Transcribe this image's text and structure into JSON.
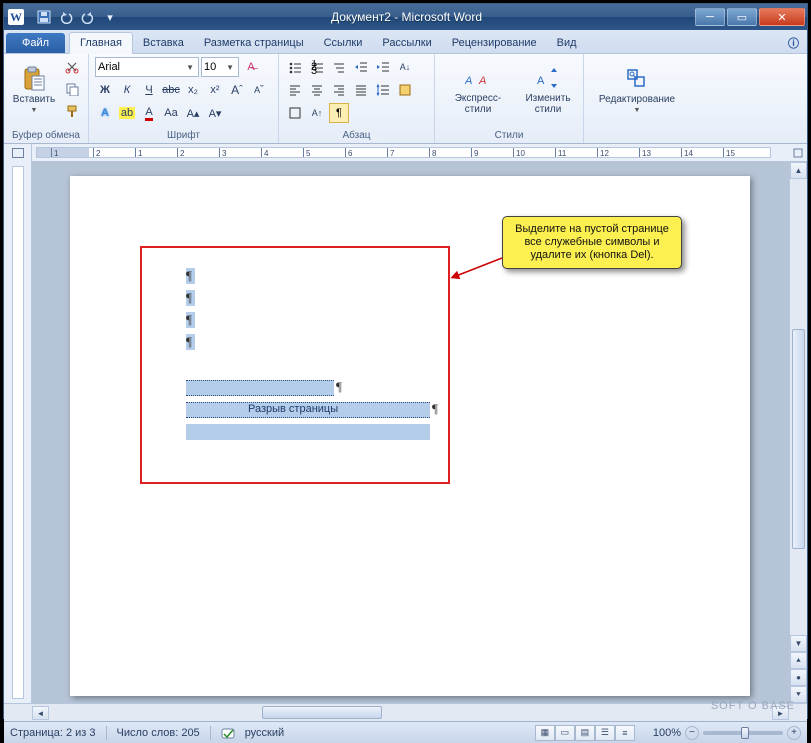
{
  "window": {
    "title": "Документ2 - Microsoft Word",
    "word_icon_letter": "W"
  },
  "tabs": {
    "file": "Файл",
    "items": [
      "Главная",
      "Вставка",
      "Разметка страницы",
      "Ссылки",
      "Рассылки",
      "Рецензирование",
      "Вид"
    ],
    "active_index": 0
  },
  "ribbon": {
    "clipboard": {
      "paste": "Вставить",
      "group": "Буфер обмена"
    },
    "font": {
      "name": "Arial",
      "size": "10",
      "group": "Шрифт",
      "bold": "Ж",
      "italic": "К",
      "underline": "Ч",
      "strike": "abc",
      "sub": "x₂",
      "sup": "x²",
      "grow": "A",
      "shrink": "A",
      "case": "Aa",
      "clear": "A"
    },
    "paragraph": {
      "group": "Абзац",
      "show_marks": "¶"
    },
    "styles": {
      "quick": "Экспресс-стили",
      "change": "Изменить стили",
      "group": "Стили"
    },
    "editing": {
      "label": "Редактирование"
    }
  },
  "ruler": {
    "marks": [
      "1",
      "2",
      "1",
      "2",
      "3",
      "4",
      "5",
      "6",
      "7",
      "8",
      "9",
      "10",
      "11",
      "12",
      "13",
      "14",
      "15"
    ]
  },
  "document": {
    "pilcrow": "¶",
    "page_break": "Разрыв страницы"
  },
  "callout": {
    "text": "Выделите на пустой странице все служебные символы и удалите их (кнопка Del)."
  },
  "status": {
    "page": "Страница: 2 из 3",
    "words": "Число слов: 205",
    "language": "русский",
    "zoom": "100%"
  },
  "watermark": "SOFT O BASE"
}
